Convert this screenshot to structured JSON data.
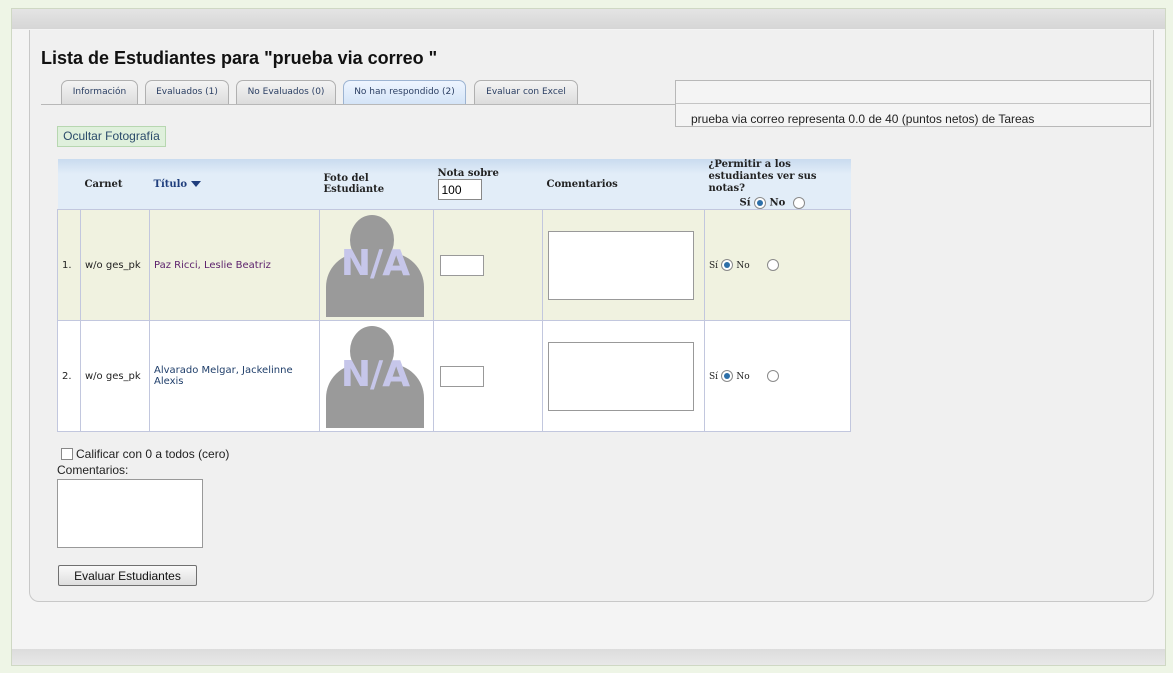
{
  "page": {
    "title": "Lista de Estudiantes para \"prueba via correo \"",
    "summary": "prueba via correo representa 0.0 de 40 (puntos netos) de Tareas"
  },
  "tabs": [
    {
      "label": "Información",
      "active": false
    },
    {
      "label": "Evaluados (1)",
      "active": false
    },
    {
      "label": "No Evaluados (0)",
      "active": false
    },
    {
      "label": "No han respondido (2)",
      "active": true
    },
    {
      "label": "Evaluar con Excel",
      "active": false
    }
  ],
  "photo_toggle_label": "Ocultar Fotografía",
  "table": {
    "headers": {
      "carnet": "Carnet",
      "titulo": "Título",
      "foto": "Foto del Estudiante",
      "nota": "Nota sobre",
      "nota_max": "100",
      "comentarios": "Comentarios",
      "permitir": "¿Permitir a los estudiantes ver sus notas?",
      "si": "Sí",
      "no": "No"
    },
    "rows": [
      {
        "num": "1.",
        "carnet": "w/o ges_pk",
        "name": "Paz Ricci, Leslie Beatriz",
        "photo": "N/A",
        "grade": "",
        "comment": "",
        "si": "Sí",
        "no": "No",
        "permit": "si"
      },
      {
        "num": "2.",
        "carnet": "w/o ges_pk",
        "name": "Alvarado Melgar, Jackelinne Alexis",
        "photo": "N/A",
        "grade": "",
        "comment": "",
        "si": "Sí",
        "no": "No",
        "permit": "si"
      }
    ]
  },
  "zero_all_label": "Calificar con 0 a todos (cero)",
  "comments_label": "Comentarios:",
  "global_comment": "",
  "submit_label": "Evaluar Estudiantes",
  "colors": {
    "accent": "#2d6fa8",
    "tab_active": "#d4e4f7",
    "row_alt": "#f0f2e0"
  }
}
